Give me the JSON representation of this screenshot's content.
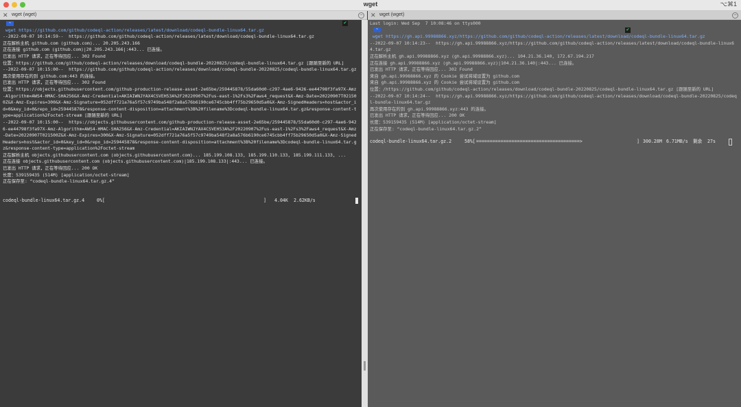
{
  "window": {
    "title": "wget",
    "shortcut": "⌥⌘1"
  },
  "tabs": [
    {
      "label": "wget (wget)"
    },
    {
      "label": "wget (wget)"
    }
  ],
  "left_terminal": {
    "prompt_symbol": "~",
    "command_line": " wget https://github.com/github/codeql-action/releases/latest/download/codeql-bundle-linux64.tar.gz",
    "output": "--2022-09-07 10:14:59--  https://github.com/github/codeql-action/releases/latest/download/codeql-bundle-linux64.tar.gz\n正在解析主机 github.com (github.com)... 20.205.243.166\n正在连接 github.com (github.com)|20.205.243.166|:443... 已连接。\n已发出 HTTP 请求，正在等待回应... 302 Found\n位置：https://github.com/github/codeql-action/releases/download/codeql-bundle-20220825/codeql-bundle-linux64.tar.gz [跟随至新的 URL]\n--2022-09-07 10:15:00--  https://github.com/github/codeql-action/releases/download/codeql-bundle-20220825/codeql-bundle-linux64.tar.gz\n再次使用存在的到 github.com:443 的连接。\n已发出 HTTP 请求，正在等待回应... 302 Found\n位置：https://objects.githubusercontent.com/github-production-release-asset-2e65be/259445878/55da60d0-c297-4ae6-9426-ee44798f3fa97X-Amz-Algorithm=AWS4-HMAC-SHA256&X-Amz-Credential=AKIAIWNJYAX4CSVEH53A%2F20220907%2Fus-east-1%2Fs3%2Faws4_request&X-Amz-Date=20220907T021500Z&X-Amz-Expires=300&X-Amz-Signature=052dff721a76a5f57c9749ba548f2a8a576b6190ce6745cbb4ff75b29650d5a0&X-Amz-SignedHeaders=host&actor_id=0&key_id=0&repo_id=259445878&response-content-disposition=attachment%3B%20filename%3Dcodeql-bundle-linux64.tar.gz&response-content-type=application%2Foctet-stream [跟随至新的 URL]\n--2022-09-07 10:15:00--  https://objects.githubusercontent.com/github-production-release-asset-2e65be/259445878/55da60d0-c297-4ae6-9426-ee44798f3fa97X-Amz-Algorithm=AWS4-HMAC-SHA256&X-Amz-Credential=AKIAIWNJYAX4CSVEH53A%2F20220907%2Fus-east-1%2Fs3%2Faws4_request&X-Amz-Date=20220907T021500Z&X-Amz-Expires=300&X-Amz-Signature=052dff721a76a5f57c9749ba548f2a8a576b6190ce6745cbb4ff75b29650d5a0&X-Amz-SignedHeaders=host&actor_id=0&key_id=0&repo_id=259445878&response-content-disposition=attachment%3B%20filename%3Dcodeql-bundle-linux64.tar.gz&response-content-type=application%2Foctet-stream\n正在解析主机 objects.githubusercontent.com (objects.githubusercontent.com)... 185.199.108.133, 185.199.110.133, 185.199.111.133, ...\n正在连接 objects.githubusercontent.com (objects.githubusercontent.com)|185.199.108.133|:443... 已连接。\n已发出 HTTP 请求，正在等待回应... 200 OK\n长度：539159435 (514M) [application/octet-stream]\n正在保存至: “codeql-bundle-linux64.tar.gz.4”",
    "progress": {
      "filename": "codeql-bundle-linux64.tar.gz.4",
      "percent": "0%[",
      "fraction": 0.0,
      "bracket_end": "]",
      "size": "4.04K",
      "speed": "2.62KB/s"
    }
  },
  "right_terminal": {
    "last_login": "Last login: Wed Sep  7 10:08:46 on ttys000",
    "prompt_symbol": "~",
    "command_line": " wget https://gh.api.99988866.xyz/https://github.com/github/codeql-action/releases/latest/download/codeql-bundle-linux64.tar.gz",
    "output": "--2022-09-07 10:14:23--  https://gh.api.99988866.xyz/https://github.com/github/codeql-action/releases/latest/download/codeql-bundle-linux64.tar.gz\n正在解析主机 gh.api.99988866.xyz (gh.api.99988866.xyz)... 104.21.36.140, 172.67.194.217\n正在连接 gh.api.99988866.xyz (gh.api.99988866.xyz)|104.21.36.140|:443... 已连接。\n已发出 HTTP 请求，正在等待回应... 302 Found\n来自 gh.api.99988866.xyz 的 Cookie 尝试将域设置为 github.com\n来自 gh.api.99988866.xyz 的 Cookie 尝试将域设置为 github.com\n位置：/https://github.com/github/codeql-action/releases/download/codeql-bundle-20220825/codeql-bundle-linux64.tar.gz [跟随至新的 URL]\n--2022-09-07 10:14:24--  https://gh.api.99988866.xyz/https://github.com/github/codeql-action/releases/download/codeql-bundle-20220825/codeql-bundle-linux64.tar.gz\n再次使用存在的到 gh.api.99988866.xyz:443 的连接。\n已发出 HTTP 请求，正在等待回应... 200 OK\n长度：539159435 (514M) [application/octet-stream]\n正在保存至: “codeql-bundle-linux64.tar.gz.2”",
    "progress": {
      "filename": "codeql-bundle-linux64.tar.gz.2",
      "percent": "58%[",
      "fraction": 0.58,
      "bar": "======================================>",
      "bracket_end": "]",
      "size": "300.28M",
      "speed": "6.71MB/s",
      "eta_label": "剩余",
      "eta": "27s"
    }
  }
}
